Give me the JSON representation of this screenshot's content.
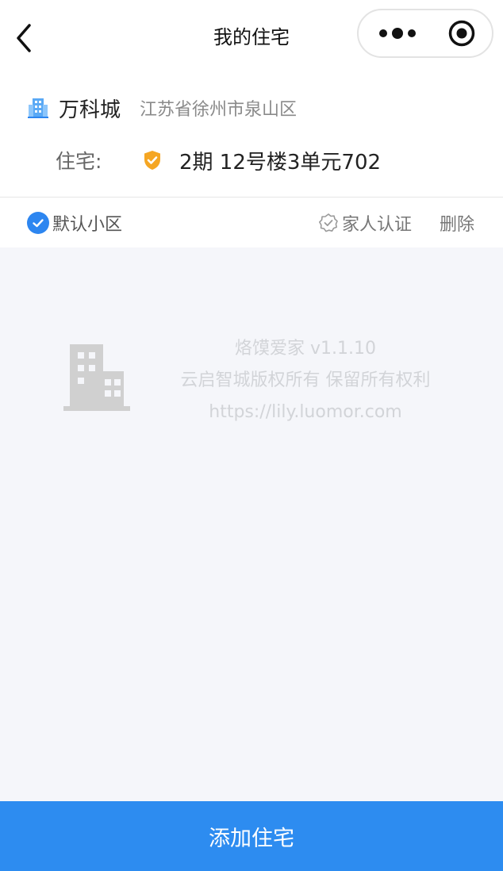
{
  "nav": {
    "title": "我的住宅",
    "back_icon": "chevron-left-icon",
    "more_icon": "more-dots-icon",
    "close_icon": "target-circle-icon"
  },
  "community": {
    "icon": "building-icon",
    "name": "万科城",
    "address": "江苏省徐州市泉山区"
  },
  "house": {
    "label": "住宅:",
    "verified_icon": "shield-check-icon",
    "value": "2期 12号楼3单元702"
  },
  "actions": {
    "default_label": "默认小区",
    "default_checked": true,
    "family_label": "家人认证",
    "delete_label": "删除"
  },
  "watermark": {
    "icon": "building-outline-icon",
    "line1": "烙馍爱家 v1.1.10",
    "line2": "云启智城版权所有 保留所有权利",
    "line3": "https://lily.luomor.com"
  },
  "footer": {
    "add_label": "添加住宅"
  },
  "colors": {
    "accent": "#2d8cf0",
    "shield": "#f5a623",
    "watermark_text": "#d2d4d8"
  }
}
